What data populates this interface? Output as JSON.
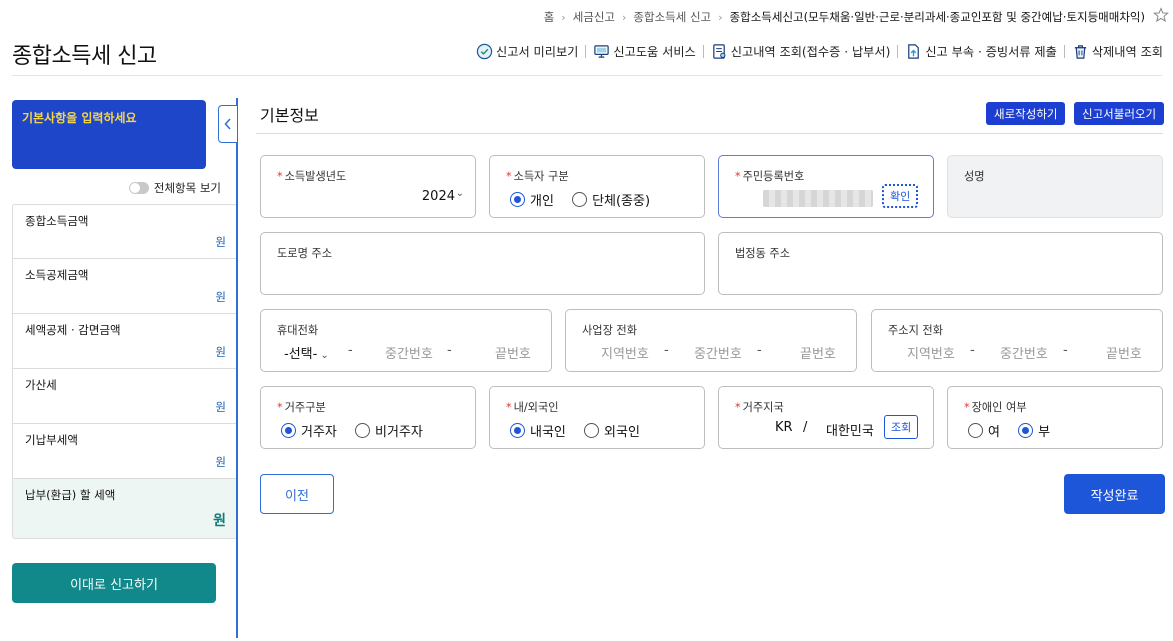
{
  "breadcrumb": [
    "홈",
    "세금신고",
    "종합소득세 신고",
    "종합소득세신고(모두채움·일반·근로·분리과세·종교인포함 및 중간예납·토지등매매차익)"
  ],
  "page_title": "종합소득세 신고",
  "toolbar": [
    {
      "label": "신고서 미리보기",
      "icon": "check-circle-icon"
    },
    {
      "label": "신고도움 서비스",
      "icon": "monitor-help-icon"
    },
    {
      "label": "신고내역 조회(접수증 · 납부서)",
      "icon": "document-search-icon"
    },
    {
      "label": "신고 부속 · 증빙서류 제출",
      "icon": "document-upload-icon"
    },
    {
      "label": "삭제내역 조회",
      "icon": "trash-icon"
    }
  ],
  "sidebar": {
    "banner": "기본사항을 입력하세요",
    "toggle_label": "전체항목 보기",
    "items": [
      {
        "label": "종합소득금액",
        "unit": "원"
      },
      {
        "label": "소득공제금액",
        "unit": "원"
      },
      {
        "label": "세액공제 · 감면금액",
        "unit": "원"
      },
      {
        "label": "가산세",
        "unit": "원"
      },
      {
        "label": "기납부세액",
        "unit": "원"
      },
      {
        "label": "납부(환급) 할 세액",
        "unit": "원"
      }
    ],
    "report_button": "이대로 신고하기"
  },
  "main": {
    "title": "기본정보",
    "new_button": "새로작성하기",
    "load_button": "신고서불러오기",
    "year": {
      "label": "소득발생년도",
      "value": "2024"
    },
    "earner": {
      "label": "소득자 구분",
      "opt1": "개인",
      "opt2": "단체(종중)"
    },
    "resident_no": {
      "label": "주민등록번호",
      "button": "확인"
    },
    "name": {
      "label": "성명"
    },
    "road_address": {
      "label": "도로명 주소"
    },
    "lot_address": {
      "label": "법정동 주소"
    },
    "mobile": {
      "label": "휴대전화",
      "select": "-선택-",
      "middle": "중간번호",
      "last": "끝번호"
    },
    "work_phone": {
      "label": "사업장 전화",
      "area": "지역번호",
      "middle": "중간번호",
      "last": "끝번호"
    },
    "home_phone": {
      "label": "주소지 전화",
      "area": "지역번호",
      "middle": "중간번호",
      "last": "끝번호"
    },
    "residency": {
      "label": "거주구분",
      "opt1": "거주자",
      "opt2": "비거주자"
    },
    "nationality": {
      "label": "내/외국인",
      "opt1": "내국인",
      "opt2": "외국인"
    },
    "country": {
      "label": "거주지국",
      "code": "KR",
      "sep": "/",
      "name": "대한민국",
      "button": "조회"
    },
    "disabled": {
      "label": "장애인 여부",
      "opt1": "여",
      "opt2": "부"
    },
    "prev_button": "이전",
    "done_button": "작성완료"
  },
  "colors": {
    "primary": "#1d56d8",
    "banner": "#1d46c8",
    "teal": "#11888a",
    "required": "#e5322d"
  }
}
